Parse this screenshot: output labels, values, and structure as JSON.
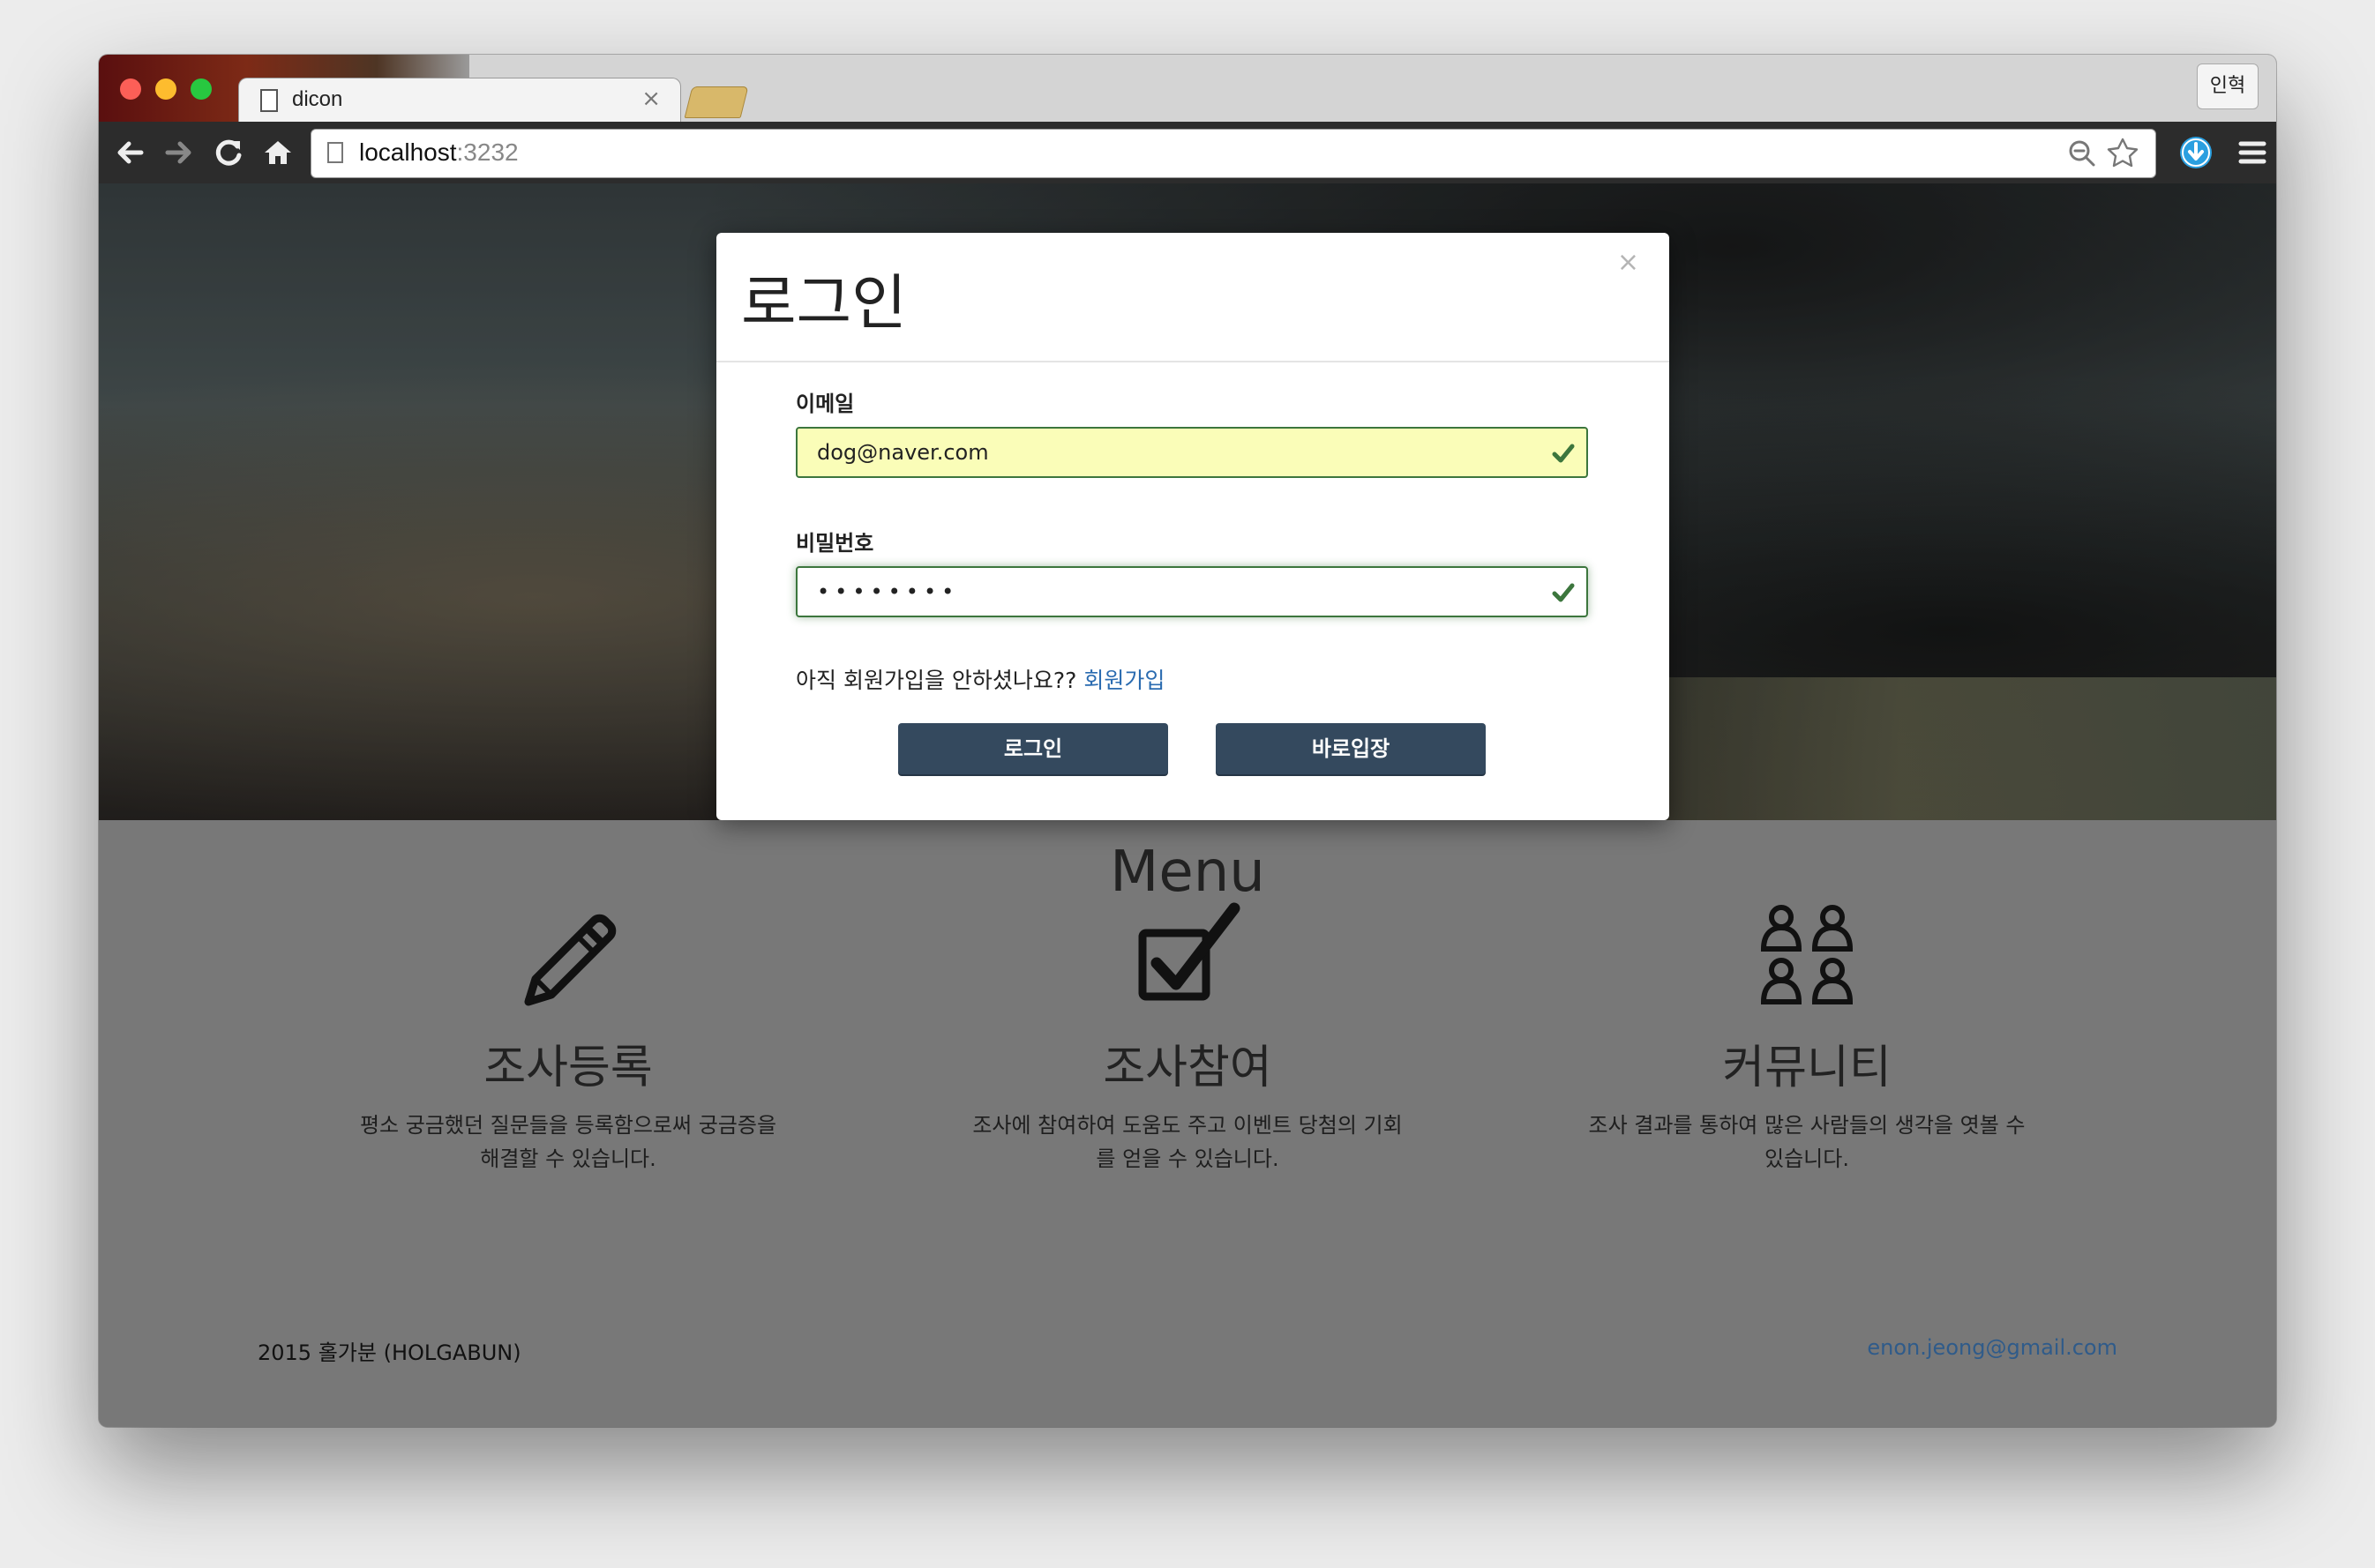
{
  "browser": {
    "tab_title": "dicon",
    "tab_close": "×",
    "profile_label": "인혁",
    "url_host": "localhost",
    "url_port": ":3232"
  },
  "modal": {
    "title": "로그인",
    "close_label": "×",
    "email_label": "이메일",
    "email_value": "dog@naver.com",
    "password_label": "비밀번호",
    "password_value": "••••••••",
    "signup_prompt": "아직 회원가입을 안하셨나요?? ",
    "signup_link": "회원가입",
    "login_button": "로그인",
    "guest_button": "바로입장"
  },
  "menu": {
    "title": "Menu",
    "features": [
      {
        "icon": "pencil-icon",
        "title": "조사등록",
        "desc": "평소 궁금했던 질문들을 등록함으로써 궁금증을 해결할 수 있습니다."
      },
      {
        "icon": "checkbox-icon",
        "title": "조사참여",
        "desc": "조사에 참여하여 도움도 주고 이벤트 당첨의 기회를 얻을 수 있습니다."
      },
      {
        "icon": "people-icon",
        "title": "커뮤니티",
        "desc": "조사 결과를 통하여 많은 사람들의 생각을 엿볼 수 있습니다."
      }
    ]
  },
  "footer": {
    "copyright": "2015 홀가분 (HOLGABUN)",
    "email": "enon.jeong@gmail.com"
  },
  "colors": {
    "button": "#34495e",
    "link": "#2a6bb0",
    "valid": "#3c763d",
    "autofill": "#fafdb8"
  }
}
